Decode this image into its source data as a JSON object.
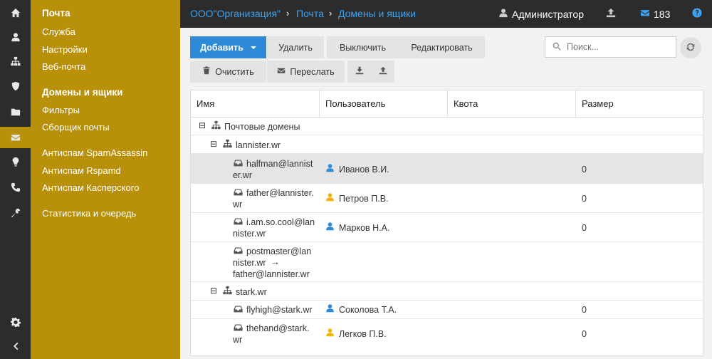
{
  "rail": {
    "items": [
      {
        "icon": "home-icon"
      },
      {
        "icon": "user-icon"
      },
      {
        "icon": "sitemap-icon"
      },
      {
        "icon": "shield-icon"
      },
      {
        "icon": "folder-icon"
      },
      {
        "icon": "envelope-icon",
        "active": true
      },
      {
        "icon": "lightbulb-icon"
      },
      {
        "icon": "phone-icon"
      },
      {
        "icon": "wrench-icon"
      }
    ],
    "bottom": [
      {
        "icon": "gear-icon"
      },
      {
        "icon": "chevron-left-icon"
      }
    ]
  },
  "sidebar": {
    "title": "Почта",
    "items": [
      {
        "label": "Служба"
      },
      {
        "label": "Настройки"
      },
      {
        "label": "Веб-почта"
      },
      {
        "label": "Домены и ящики",
        "active": true
      },
      {
        "label": "Фильтры"
      },
      {
        "label": "Сборщик почты"
      },
      {
        "label": "Антиспам SpamAssassin"
      },
      {
        "label": "Антиспам Rspamd"
      },
      {
        "label": "Антиспам Касперского"
      },
      {
        "label": "Статистика и очередь"
      }
    ]
  },
  "header": {
    "breadcrumb": [
      "ООО\"Организация\"",
      "Почта",
      "Домены и ящики"
    ],
    "separator": "›",
    "user": "Администратор",
    "messages_count": "183",
    "upload_icon": "upload-icon",
    "help_icon": "question-icon"
  },
  "toolbar": {
    "add": "Добавить",
    "delete": "Удалить",
    "disable": "Выключить",
    "edit": "Редактировать",
    "clear": "Очистить",
    "forward": "Переслать",
    "search_placeholder": "Поиск..."
  },
  "table": {
    "columns": [
      "Имя",
      "Пользователь",
      "Квота",
      "Размер"
    ],
    "root": {
      "toggle": "⊟",
      "label": "Почтовые домены"
    },
    "domains": [
      {
        "toggle": "⊟",
        "name": "lannister.wr",
        "mailboxes": [
          {
            "name_lines": [
              "halfman@lannist",
              "er.wr"
            ],
            "user": "Иванов В.И.",
            "user_color": "#2d8ad6",
            "size": "0",
            "selected": true
          },
          {
            "name_lines": [
              "father@lannister.",
              "wr"
            ],
            "user": "Петров П.В.",
            "user_color": "#f0b400",
            "size": "0"
          },
          {
            "name_lines": [
              "i.am.so.cool@lan",
              "nister.wr"
            ],
            "user": "Марков Н.А.",
            "user_color": "#2d8ad6",
            "size": "0"
          },
          {
            "name_lines": [
              "postmaster@lan",
              "nister.wr",
              "father@lannister.wr"
            ],
            "forward_arrow": "→",
            "user": "",
            "size": ""
          }
        ]
      },
      {
        "toggle": "⊟",
        "name": "stark.wr",
        "mailboxes": [
          {
            "name_lines": [
              "flyhigh@stark.wr"
            ],
            "user": "Соколова Т.А.",
            "user_color": "#2d8ad6",
            "size": "0"
          },
          {
            "name_lines": [
              "thehand@stark.",
              "wr"
            ],
            "user": "Легков П.В.",
            "user_color": "#f0b400",
            "size": "0"
          }
        ]
      }
    ]
  }
}
